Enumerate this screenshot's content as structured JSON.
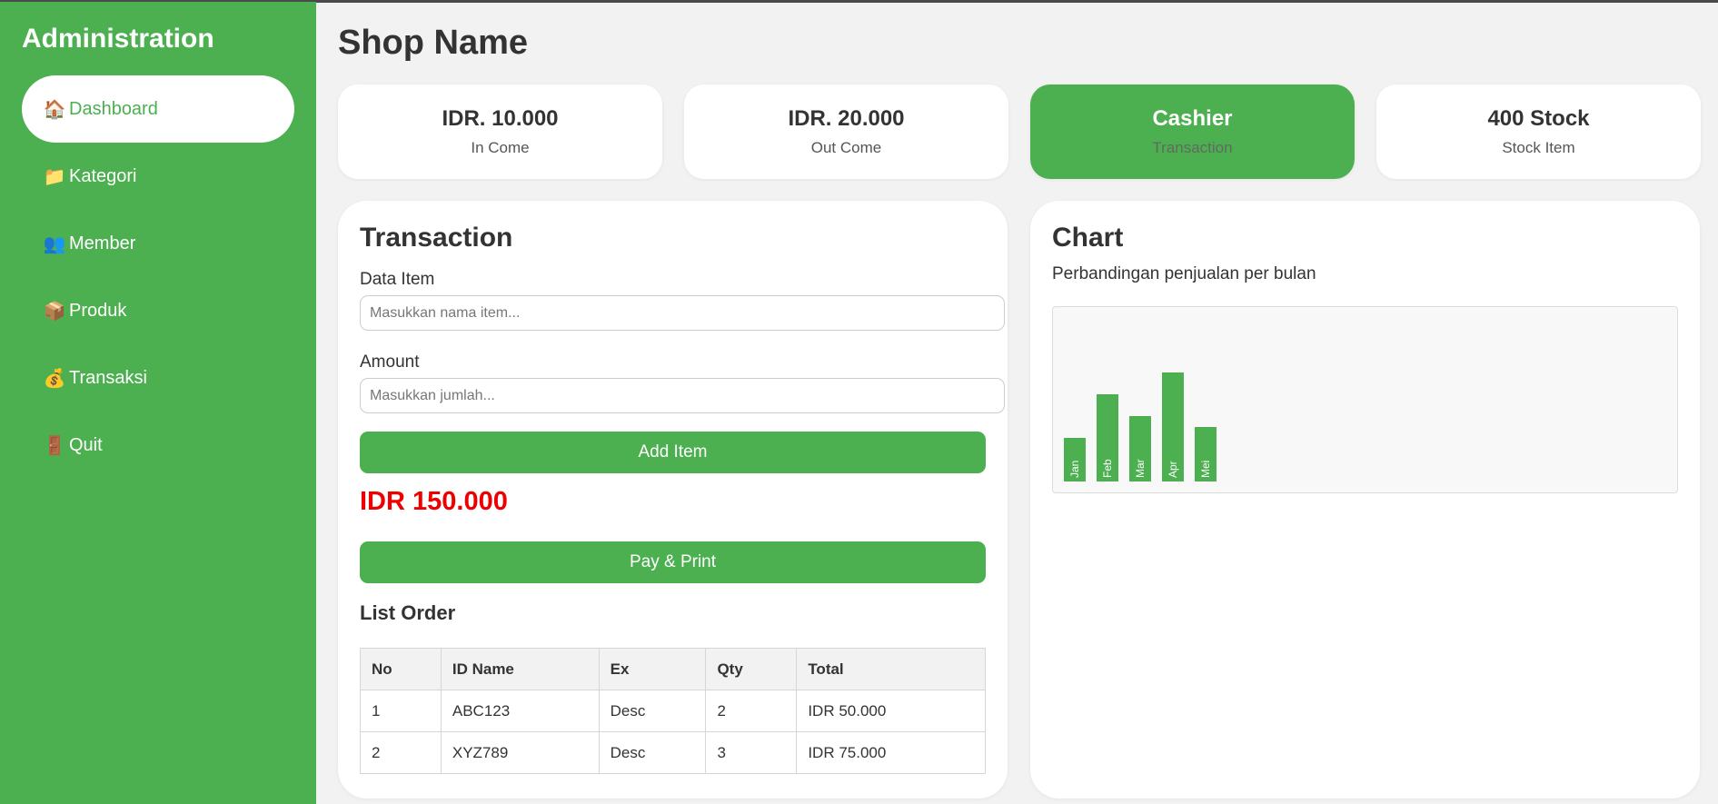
{
  "sidebar": {
    "title": "Administration",
    "items": [
      {
        "label": "Dashboard",
        "icon": "🏠",
        "icon_name": "home-icon",
        "active": true
      },
      {
        "label": "Kategori",
        "icon": "📁",
        "icon_name": "folder-icon",
        "active": false
      },
      {
        "label": "Member",
        "icon": "👥",
        "icon_name": "users-icon",
        "active": false
      },
      {
        "label": "Produk",
        "icon": "📦",
        "icon_name": "package-icon",
        "active": false
      },
      {
        "label": "Transaksi",
        "icon": "💰",
        "icon_name": "money-bag-icon",
        "active": false
      },
      {
        "label": "Quit",
        "icon": "🚪",
        "icon_name": "door-icon",
        "active": false
      }
    ]
  },
  "header": {
    "title": "Shop Name"
  },
  "stats": [
    {
      "value": "IDR. 10.000",
      "label": "In Come"
    },
    {
      "value": "IDR. 20.000",
      "label": "Out Come"
    },
    {
      "value": "Cashier",
      "label": "Transaction"
    },
    {
      "value": "400 Stock",
      "label": "Stock Item"
    }
  ],
  "transaction": {
    "title": "Transaction",
    "data_item_label": "Data Item",
    "data_item_placeholder": "Masukkan nama item...",
    "amount_label": "Amount",
    "amount_placeholder": "Masukkan jumlah...",
    "add_button": "Add Item",
    "total": "IDR 150.000",
    "pay_button": "Pay & Print",
    "list_title": "List Order",
    "columns": [
      "No",
      "ID Name",
      "Ex",
      "Qty",
      "Total"
    ],
    "rows": [
      [
        "1",
        "ABC123",
        "Desc",
        "2",
        "IDR 50.000"
      ],
      [
        "2",
        "XYZ789",
        "Desc",
        "3",
        "IDR 75.000"
      ]
    ]
  },
  "chart": {
    "title": "Chart",
    "subtitle": "Perbandingan penjualan per bulan"
  },
  "colors": {
    "accent": "#4caf50",
    "total_red": "#ee0000"
  },
  "chart_data": {
    "type": "bar",
    "categories": [
      "Jan",
      "Feb",
      "Mar",
      "Apr",
      "Mei"
    ],
    "values": [
      40,
      80,
      60,
      100,
      50
    ],
    "ylim": [
      0,
      100
    ],
    "grid": false,
    "legend": "none"
  }
}
